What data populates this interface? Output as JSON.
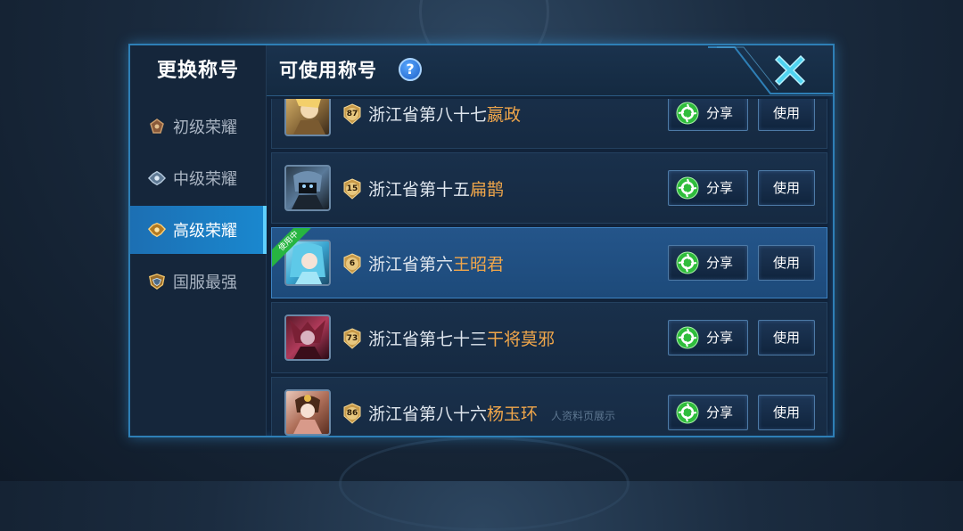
{
  "sidebar": {
    "title": "更换称号",
    "items": [
      {
        "label": "初级荣耀",
        "icon": "bronze-crest-icon",
        "active": false
      },
      {
        "label": "中级荣耀",
        "icon": "silver-crest-icon",
        "active": false
      },
      {
        "label": "高级荣耀",
        "icon": "gold-crest-icon",
        "active": true
      },
      {
        "label": "国服最强",
        "icon": "national-crest-icon",
        "active": false
      }
    ]
  },
  "header": {
    "title": "可使用称号",
    "help_label": "?"
  },
  "titles": [
    {
      "rank": "87",
      "prefix": "浙江省第八十七",
      "hero": "嬴政",
      "share_label": "分享",
      "use_label": "使用",
      "selected": false,
      "badge": ""
    },
    {
      "rank": "15",
      "prefix": "浙江省第十五",
      "hero": "扁鹊",
      "share_label": "分享",
      "use_label": "使用",
      "selected": false,
      "badge": ""
    },
    {
      "rank": "6",
      "prefix": "浙江省第六",
      "hero": "王昭君",
      "share_label": "分享",
      "use_label": "使用",
      "selected": true,
      "badge": "使用中"
    },
    {
      "rank": "73",
      "prefix": "浙江省第七十三",
      "hero": "干将莫邪",
      "share_label": "分享",
      "use_label": "使用",
      "selected": false,
      "badge": ""
    },
    {
      "rank": "86",
      "prefix": "浙江省第八十六",
      "hero": "杨玉环",
      "share_label": "分享",
      "use_label": "使用",
      "selected": false,
      "badge": ""
    }
  ],
  "footer_hint": "人资料页展示",
  "colors": {
    "accent": "#1a88cf",
    "hero_name": "#f0a64a",
    "share_green": "#2fbd3c",
    "close_cyan": "#4fd3f0"
  }
}
